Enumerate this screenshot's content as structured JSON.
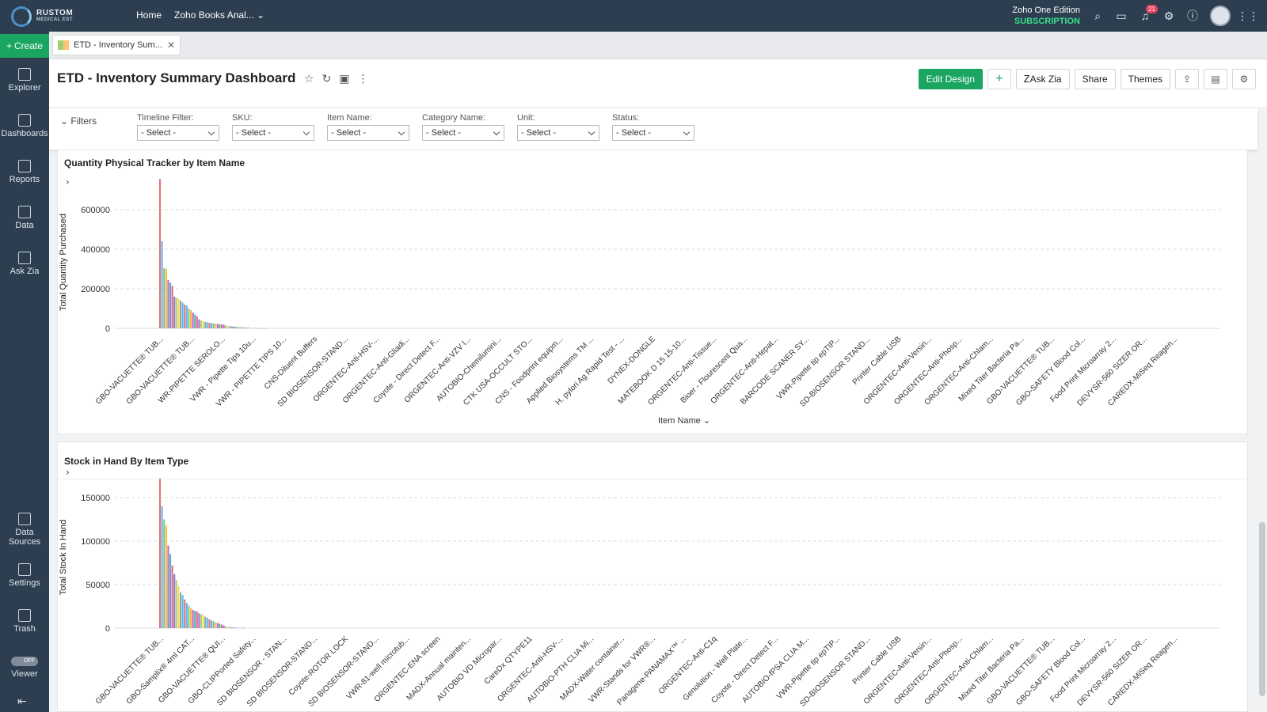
{
  "brand": {
    "name": "RUSTOM",
    "sub": "MEDICAL EST"
  },
  "topnav": {
    "home": "Home",
    "workspace": "Zoho Books Anal..."
  },
  "edition": {
    "title": "Zoho One Edition",
    "subscription": "SUBSCRIPTION"
  },
  "notifications": {
    "count": "21"
  },
  "sidebar": {
    "create": "Create",
    "items": [
      "Explorer",
      "Dashboards",
      "Reports",
      "Data",
      "Ask Zia"
    ],
    "bottom": [
      "Data Sources",
      "Settings",
      "Trash",
      "Viewer"
    ],
    "toggle": "OFF"
  },
  "tab": {
    "label": "ETD - Inventory Sum..."
  },
  "page": {
    "title": "ETD - Inventory Summary Dashboard"
  },
  "actions": {
    "edit_design": "Edit Design",
    "ask_zia": "Ask Zia",
    "share": "Share",
    "themes": "Themes"
  },
  "filters": {
    "toggle": "Filters",
    "items": [
      {
        "label": "Timeline Filter:",
        "value": "- Select -"
      },
      {
        "label": "SKU:",
        "value": "- Select -"
      },
      {
        "label": "Item Name:",
        "value": "- Select -"
      },
      {
        "label": "Category Name:",
        "value": "- Select -"
      },
      {
        "label": "Unit:",
        "value": "- Select -"
      },
      {
        "label": "Status:",
        "value": "- Select -"
      }
    ]
  },
  "chart_data": [
    {
      "type": "bar",
      "title": "Quantity Physical Tracker by Item Name",
      "ylabel": "Total Quantity Purchased",
      "xlabel": "Item Name",
      "ylim": [
        0,
        700000
      ],
      "yticks": [
        0,
        200000,
        400000,
        600000
      ],
      "grid": true,
      "tick_labels": [
        "GBO-VACUETTE® TUB...",
        "GBO-VACUETTE® TUB...",
        "WR-PIPETTE SEROLO...",
        "VWR - Pipette Tips 10u...",
        "VWR - PIPETTE TIPS 10...",
        "CNS-Diluent Buffers",
        "SD BIOSENSOR-STAND...",
        "ORGENTEC-Anti-HSV-...",
        "ORGENTEC-Anti-Gliadi...",
        "Coyote - Direct Detect F...",
        "ORGENTEC-Anti-VZV I...",
        "AUTOBIO-Chemilumini...",
        "CTK USA-OCCULT STO...",
        "CNS - Foodprint equipm...",
        "Applied Biosystems TM ...",
        "H. pylori Ag Rapid Test - ...",
        "DYNEX-DONGLE",
        "MATEBOOK D 15 15-10...",
        "ORGENTEC-Anti-Tissue...",
        "Bioer - Flourescent Qua...",
        "ORGENTEC-Anti-Hepat...",
        "BARCODE SCANER SY...",
        "VWR-Pipette tip epTIP...",
        "SD-BIOSENSOR STAND...",
        "Printer Cable USB",
        "ORGENTEC-Anti-Versin...",
        "ORGENTEC-Anti-Phosp...",
        "ORGENTEC-Anti-Chlam...",
        "Mixed Titer Bacteria Pa...",
        "GBO-VACUETTE® TUB...",
        "GBO-SAFETY Blood Col...",
        "Food Print Microarray 2...",
        "DEVYSR-560 SIZER OR...",
        "CAREDX-MiSeq Reagen..."
      ],
      "values": [
        755000,
        440000,
        305000,
        300000,
        245000,
        230000,
        215000,
        160000,
        155000,
        150000,
        140000,
        130000,
        120000,
        115000,
        100000,
        92000,
        80000,
        70000,
        60000,
        45000,
        40000,
        36000,
        33000,
        30000,
        28000,
        26000,
        25000,
        24000,
        22000,
        21000,
        20000,
        18000,
        15000,
        13000,
        11000,
        10000,
        9000,
        8000,
        7000,
        6000,
        5000,
        4000,
        3000,
        2500,
        2000,
        1500,
        1200,
        1000,
        800,
        600,
        400,
        300,
        200
      ]
    },
    {
      "type": "bar",
      "title": "Stock in Hand By Item Type",
      "ylabel": "Total Stock In Hand",
      "ylim": [
        0,
        170000
      ],
      "yticks": [
        0,
        50000,
        100000,
        150000
      ],
      "grid": true,
      "tick_labels": [
        "GBO-VACUETTE® TUB...",
        "GBO-Samplix® 4ml CAT...",
        "GBO-VACUETTE® QUI...",
        "GBO-CLIPPorted Safety...",
        "SD BIOSENSOR - STAN...",
        "SD BIOSENSOR-STAND...",
        "Coyote-ROTOR LOCK",
        "SD BIOSENSOR-STAND...",
        "VWR-81-well microtub...",
        "ORGENTEC-ENA screen",
        "MADX-Annual mainten...",
        "AUTOBIO VD Micropar...",
        "CareDx QTYPE11",
        "ORGENTEC-Anti-HSV-...",
        "AUTOBIO-PTH CLIA Mi...",
        "MADX-Water container...",
        "VWR-Stands for VWR®...",
        "Panagene-PANAMAX™ ...",
        "ORGENTEC-Anti-C1q",
        "Genolution - Well Plate...",
        "Coyote - Direct Detect F...",
        "AUTOBIO-fPSA CLIA M...",
        "VWR-Pipette tip epTIP...",
        "SD-BIOSENSOR STAND...",
        "Printer Cable USB",
        "ORGENTEC-Anti-Versin...",
        "ORGENTEC-Anti-Phosp...",
        "ORGENTEC-Anti-Chlam...",
        "Mixed Titer Bacteria Pa...",
        "GBO-VACUETTE® TUB...",
        "GBO-SAFETY Blood Col...",
        "Food Print Microarray 2...",
        "DEVYSR-560 SIZER OR...",
        "CAREDX-MiSeq Reagen..."
      ],
      "values": [
        172000,
        140000,
        125000,
        118000,
        95000,
        85000,
        72000,
        62000,
        55000,
        48000,
        41000,
        38000,
        33000,
        29000,
        26000,
        23000,
        21000,
        20000,
        19000,
        17000,
        16000,
        15000,
        13000,
        12000,
        10000,
        9000,
        8000,
        7000,
        6000,
        5000,
        4000,
        3000,
        2000,
        1500,
        1200,
        1000,
        800,
        600,
        500,
        400,
        300,
        200
      ]
    }
  ]
}
